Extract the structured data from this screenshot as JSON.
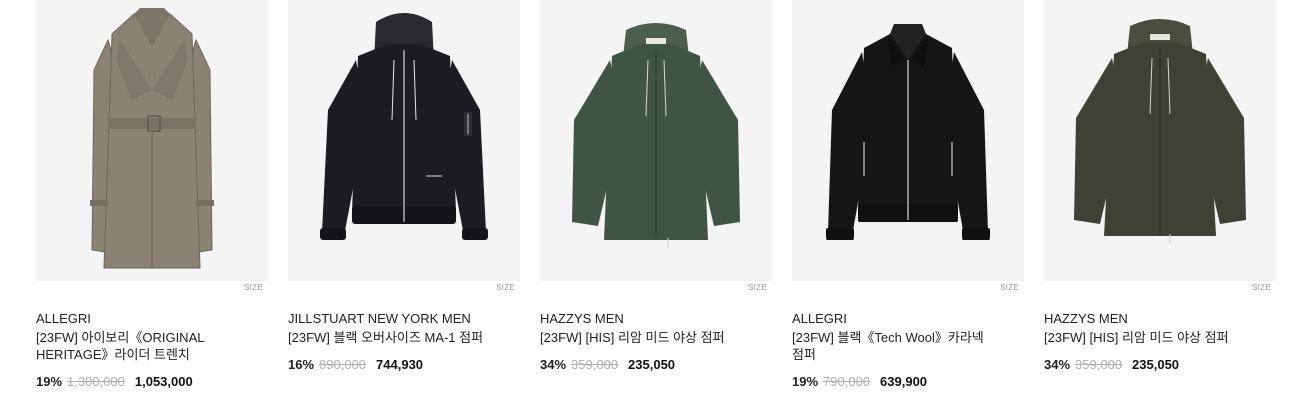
{
  "products": [
    {
      "brand": "ALLEGRI",
      "name": "[23FW] 아이보리《ORIGINAL HERITAGE》라이더 트렌치",
      "size_label": "SIZE",
      "discount": "19%",
      "original_price": "1,300,000",
      "price": "1,053,000",
      "image": "trench-coat",
      "color": "#8a8374"
    },
    {
      "brand": "JILLSTUART NEW YORK MEN",
      "name": "[23FW] 블랙 오버사이즈 MA-1 점퍼",
      "size_label": "SIZE",
      "discount": "16%",
      "original_price": "890,000",
      "price": "744,930",
      "image": "hooded-bomber",
      "color": "#1c1c22"
    },
    {
      "brand": "HAZZYS MEN",
      "name": "[23FW] [HIS] 리암 미드 야상 점퍼",
      "size_label": "SIZE",
      "discount": "34%",
      "original_price": "359,000",
      "price": "235,050",
      "image": "hooded-field-jacket",
      "color": "#3f5445"
    },
    {
      "brand": "ALLEGRI",
      "name": "[23FW] 블랙《Tech Wool》카라넥 점퍼",
      "size_label": "SIZE",
      "discount": "19%",
      "original_price": "790,000",
      "price": "639,900",
      "image": "collar-blouson",
      "color": "#151515"
    },
    {
      "brand": "HAZZYS MEN",
      "name": "[23FW] [HIS] 리암 미드 야상 점퍼",
      "size_label": "SIZE",
      "discount": "34%",
      "original_price": "359,000",
      "price": "235,050",
      "image": "hooded-field-jacket",
      "color": "#3e4234"
    }
  ]
}
